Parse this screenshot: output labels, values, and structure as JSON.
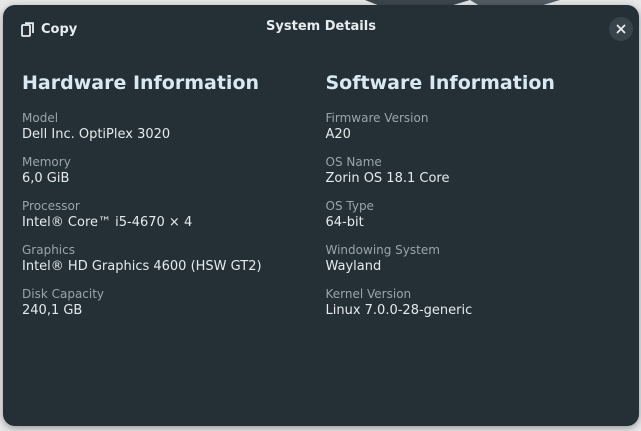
{
  "header": {
    "copy_label": "Copy",
    "title": "System Details",
    "copy_icon": "copy-icon",
    "close_icon": "close-icon"
  },
  "hardware": {
    "title": "Hardware Information",
    "fields": [
      {
        "label": "Model",
        "value": "Dell Inc. OptiPlex 3020"
      },
      {
        "label": "Memory",
        "value": "6,0 GiB"
      },
      {
        "label": "Processor",
        "value": "Intel® Core™ i5-4670 × 4"
      },
      {
        "label": "Graphics",
        "value": "Intel® HD Graphics 4600 (HSW GT2)"
      },
      {
        "label": "Disk Capacity",
        "value": "240,1 GB"
      }
    ]
  },
  "software": {
    "title": "Software Information",
    "fields": [
      {
        "label": "Firmware Version",
        "value": "A20"
      },
      {
        "label": "OS Name",
        "value": "Zorin OS 18.1 Core"
      },
      {
        "label": "OS Type",
        "value": "64-bit"
      },
      {
        "label": "Windowing System",
        "value": "Wayland"
      },
      {
        "label": "Kernel Version",
        "value": "Linux 7.0.0-28-generic"
      }
    ]
  },
  "colors": {
    "dialog_background": "#243036",
    "section_title": "#d8e9f2",
    "label": "#9aa4a9",
    "value": "#e6eaec"
  }
}
